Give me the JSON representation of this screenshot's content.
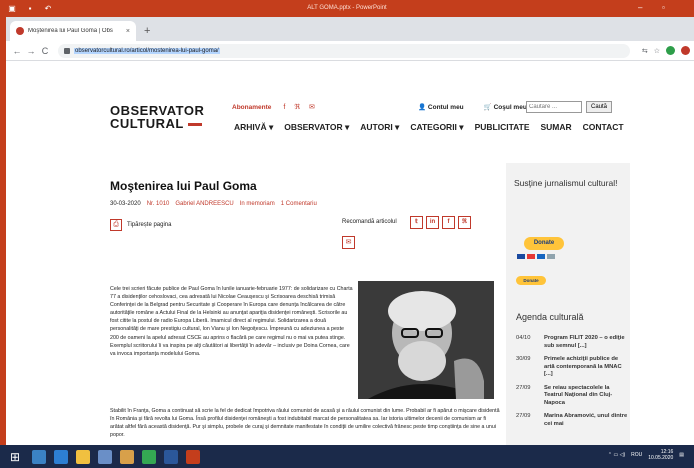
{
  "powerpoint": {
    "title": "ALT GOMA.pptx - PowerPoint"
  },
  "browser": {
    "tab_title": "Moştenirea lui Paul Goma | Obs",
    "url": "observatorcultural.ro/articol/mostenirea-lui-paul-goma/"
  },
  "site": {
    "logo_line1": "OBSERVATOR",
    "logo_line2": "CULTURAL",
    "abonamente": "Abonamente",
    "account": "Contul meu",
    "cart": "Coşul meu",
    "search_placeholder": "Căutare ...",
    "search_button": "Caută",
    "nav": [
      "ARHIVĂ ▾",
      "OBSERVATOR ▾",
      "AUTORI ▾",
      "CATEGORII ▾",
      "PUBLICITATE",
      "SUMAR",
      "CONTACT"
    ]
  },
  "article": {
    "title": "Moştenirea lui Paul Goma",
    "date": "30-03-2020",
    "issue": "Nr. 1010",
    "author": "Gabriel ANDREESCU",
    "category": "In memoriam",
    "comments": "1 Comentariu",
    "print_label": "Tipărește pagina",
    "recommend_label": "Recomandă articolul",
    "para1": "Cele trei scrieri făcute publice de Paul Goma în lunile ianuarie-februarie 1977: de solidarizare cu Charta 77 a disidenţilor cehoslovaci, cea adresată lui Nicolae Ceauşescu şi Scrisoarea deschisă trimisă Conferinţei de la Belgrad pentru Securitate şi Cooperare în Europa care denunţa încălcarea de către autorităţile române a Actului Final de la Helsinki au anunţat apariţia disidenţei româneşti. Scrisorile au fost citite la postul de radio Europa Liberă. Imamicul direct al regimului. Solidarizarea a două personalităţi de mare prestigiu cultural, Ion Vianu şi Ion Negoiţescu. Împreună cu adeziunea a peste 200 de oameni la apelul adresat CSCE au aprins o flacără pe care regimul nu o mai va putea stinge. Exemplul scriitorului îi va inspira pe alţi căutători ai libertăţii în adevăr – inclusiv pe Doina Cornea, care va invoca importanţa modelului Goma.",
    "para2": "Stabilit în Franţa, Goma a continuat să scrie la fel de dedicat împotriva răului comunist de acasă şi a răului comunist din lume. Probabil ar fi apărut o mişcare disidentă în România şi fără revolta lui Goma. Însă profilul disidenţei româneşti a fost indubitabil marcat de personalitatea sa. Iar istoria ultimelor decenii de comunism ar fi arătat altfel fără această disidenţă. Pur şi simplu, probele de curaj şi demnitate manifestate în condiţii de umilire colectivă frânesc peste timp conştiinţa de sine a unui popor."
  },
  "sidebar": {
    "support_heading": "Susţine jurnalismul cultural!",
    "donate_label": "Donate",
    "donate_small": "Donate",
    "agenda_title": "Agenda culturală",
    "agenda": [
      {
        "date": "04/10",
        "text": "Program FILIT 2020 – o ediţie sub semnul [...]"
      },
      {
        "date": "30/09",
        "text": "Primele achiziţii publice de artă contemporană la MNAC [...]"
      },
      {
        "date": "27/09",
        "text": "Se reiau spectacolele la Teatrul Naţional din Cluj-Napoca"
      },
      {
        "date": "27/09",
        "text": "Marina Abramović, unul dintre cei mai"
      }
    ]
  },
  "taskbar": {
    "lang": "ROU",
    "time": "12:16",
    "date": "10.05.2020"
  },
  "colors": {
    "brand_red": "#c0392b",
    "ppt_orange": "#c43e1c",
    "donate_yellow": "#ffc43a",
    "taskbar_navy": "#1b2a4a"
  }
}
